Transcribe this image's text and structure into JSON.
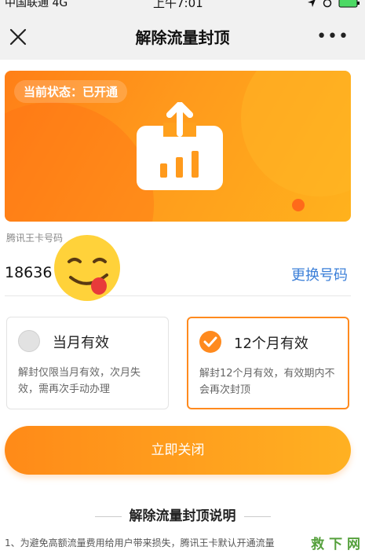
{
  "status_bar": {
    "carrier": "中国联通  4G",
    "time": "上午7:01"
  },
  "nav": {
    "title": "解除流量封顶"
  },
  "banner": {
    "status_text": "当前状态：已开通"
  },
  "phone": {
    "label": "腾讯王卡号码",
    "number": "18636",
    "change_label": "更换号码"
  },
  "options": [
    {
      "title": "当月有效",
      "desc": "解封仅限当月有效，次月失效，需再次手动办理",
      "selected": false
    },
    {
      "title": "12个月有效",
      "desc": "解封12个月有效，有效期内不会再次封顶",
      "selected": true
    }
  ],
  "close_button": {
    "label": "立即关闭"
  },
  "section": {
    "title": "解除流量封顶说明",
    "text": "1、为避免高额流量费用给用户带来损失，腾讯王卡默认开通流量"
  },
  "watermark": "救 下 网",
  "colors": {
    "accent": "#ff8a1e",
    "link": "#3b7fd8"
  }
}
